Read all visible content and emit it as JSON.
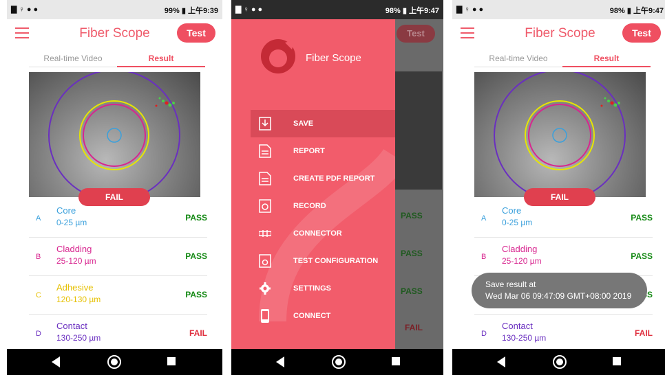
{
  "status_left": "▇ ♀ ● ●",
  "status_time": [
    "99% ▮ 上午9:39",
    "98% ▮ 上午9:47",
    "98% ▮ 上午9:47"
  ],
  "app": {
    "title": "Fiber Scope",
    "test_label": "Test"
  },
  "tabs": {
    "video": "Real-time Video",
    "result": "Result"
  },
  "overlay": {
    "status": "FAIL"
  },
  "zones": [
    {
      "letter": "A",
      "name": "Core",
      "range": "0-25 µm",
      "result": "PASS",
      "color": "#3aa0dc"
    },
    {
      "letter": "B",
      "name": "Cladding",
      "range": "25-120 µm",
      "result": "PASS",
      "color": "#d8258f"
    },
    {
      "letter": "C",
      "name": "Adhesive",
      "range": "120-130 µm",
      "result": "PASS",
      "color": "#e6c000"
    },
    {
      "letter": "D",
      "name": "Contact",
      "range": "130-250 µm",
      "result": "FAIL",
      "color": "#6a2fc0"
    }
  ],
  "drawer": {
    "title": "Fiber Scope",
    "items": [
      {
        "label": "SAVE",
        "icon": "save-icon"
      },
      {
        "label": "REPORT",
        "icon": "report-icon"
      },
      {
        "label": "CREATE PDF REPORT",
        "icon": "pdf-icon"
      },
      {
        "label": "RECORD",
        "icon": "record-icon"
      },
      {
        "label": "CONNECTOR",
        "icon": "connector-icon"
      },
      {
        "label": "TEST CONFIGURATION",
        "icon": "test-config-icon"
      },
      {
        "label": "SETTINGS",
        "icon": "gear-icon"
      },
      {
        "label": "CONNECT",
        "icon": "phone-icon"
      }
    ]
  },
  "toast": {
    "line1": "Save result at",
    "line2": "Wed Mar 06 09:47:09 GMT+08:00 2019"
  },
  "colors": {
    "accent": "#ef4f61",
    "drawer": "#f25c6b"
  }
}
